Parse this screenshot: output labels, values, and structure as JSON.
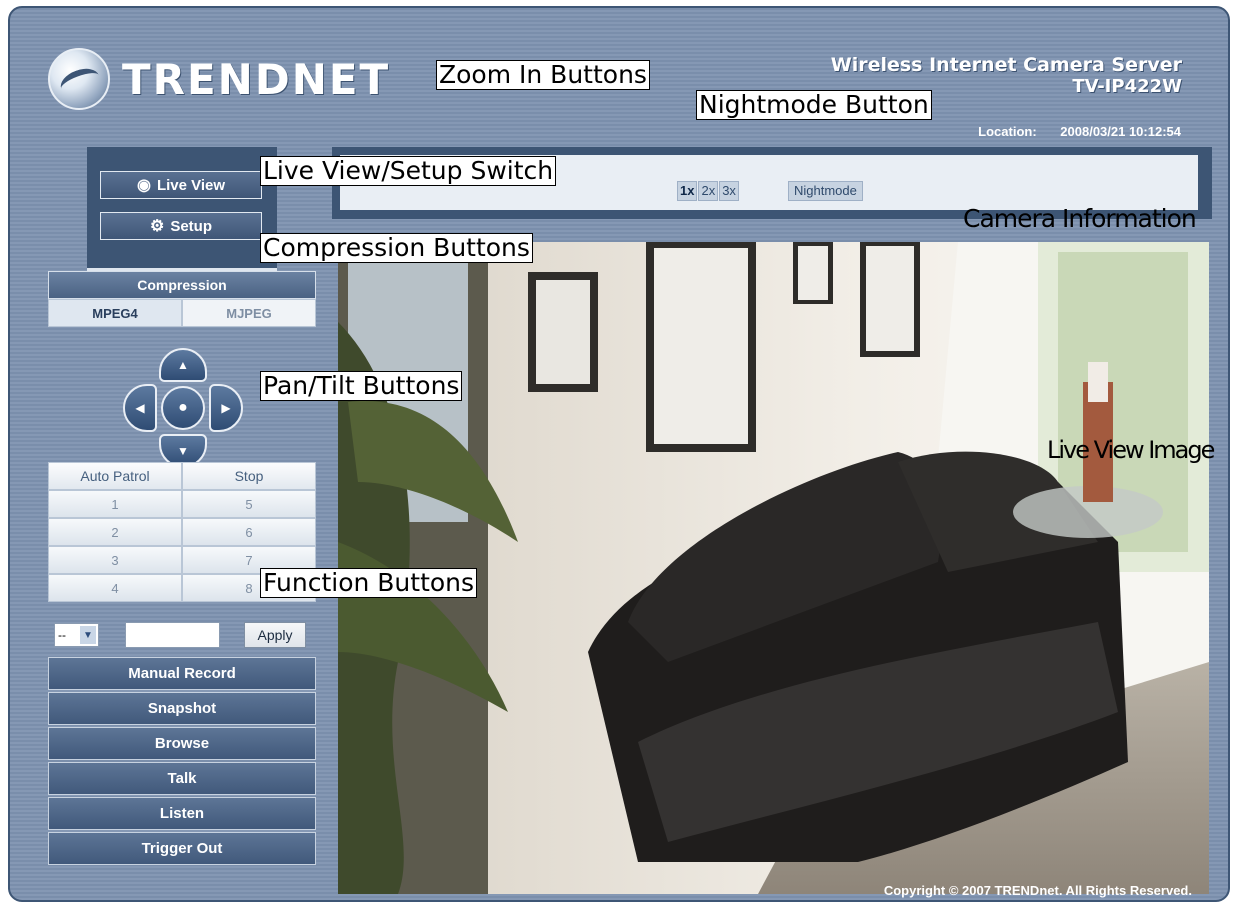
{
  "header": {
    "logo_text": "TRENDNET",
    "product_title": "Wireless Internet Camera Server",
    "product_model": "TV-IP422W",
    "location_label": "Location:",
    "datetime": "2008/03/21 10:12:54"
  },
  "mode_switch": {
    "live_view_label": "Live View",
    "setup_label": "Setup"
  },
  "toolbar": {
    "zoom": [
      "1x",
      "2x",
      "3x"
    ],
    "nightmode_label": "Nightmode"
  },
  "compression": {
    "title": "Compression",
    "options": [
      "MPEG4",
      "MJPEG"
    ],
    "selected": "MPEG4"
  },
  "patrol": {
    "auto_patrol_label": "Auto Patrol",
    "stop_label": "Stop",
    "presets": [
      "1",
      "5",
      "2",
      "6",
      "3",
      "7",
      "4",
      "8"
    ]
  },
  "preset_select": {
    "value": "--",
    "apply_label": "Apply"
  },
  "functions": [
    "Manual Record",
    "Snapshot",
    "Browse",
    "Talk",
    "Listen",
    "Trigger Out"
  ],
  "footer": {
    "copyright": "Copyright © 2007 TRENDnet. All Rights Reserved."
  },
  "annotations": {
    "zoom_in_buttons": "Zoom In Buttons",
    "nightmode_button": "Nightmode Button",
    "live_view_setup_switch": "Live View/Setup Switch",
    "camera_information": "Camera Information",
    "compression_buttons": "Compression Buttons",
    "pan_tilt_buttons": "Pan/Tilt Buttons",
    "live_view_image": "Live View Image",
    "function_buttons": "Function Buttons"
  },
  "colors": {
    "panel_bg": "#8196b2",
    "dark_panel": "#3d5574",
    "button_blue": "#4a6283"
  }
}
